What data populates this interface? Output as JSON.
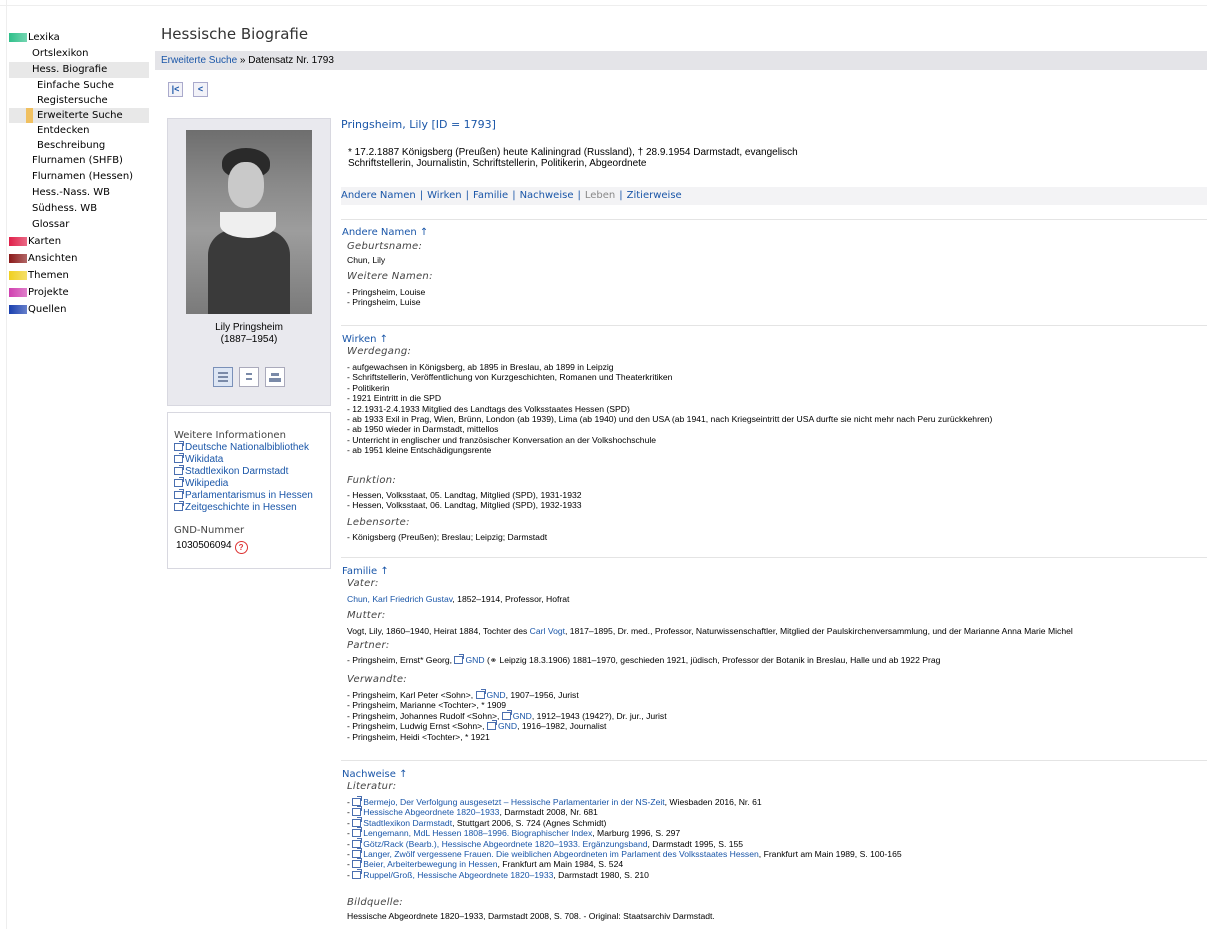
{
  "sidebar": {
    "items": [
      {
        "label": "Lexika",
        "kind": "cat",
        "color": "#2fc08a"
      },
      {
        "label": "Ortslexikon",
        "kind": "l1"
      },
      {
        "label": "Hess. Biografie",
        "kind": "l1",
        "selected": true
      },
      {
        "label": "Einfache Suche",
        "kind": "l2"
      },
      {
        "label": "Registersuche",
        "kind": "l2"
      },
      {
        "label": "Erweiterte Suche",
        "kind": "l2",
        "current": true
      },
      {
        "label": "Entdecken",
        "kind": "l2"
      },
      {
        "label": "Beschreibung",
        "kind": "l3"
      },
      {
        "label": "Flurnamen (SHFB)",
        "kind": "l1"
      },
      {
        "label": "Flurnamen (Hessen)",
        "kind": "l1"
      },
      {
        "label": "Hess.-Nass. WB",
        "kind": "l1"
      },
      {
        "label": "Südhess. WB",
        "kind": "l1"
      },
      {
        "label": "Glossar",
        "kind": "l1"
      },
      {
        "label": "Karten",
        "kind": "cat",
        "color": "#e0204a"
      },
      {
        "label": "Ansichten",
        "kind": "cat",
        "color": "#8b1a1a"
      },
      {
        "label": "Themen",
        "kind": "cat",
        "color": "#f0d020"
      },
      {
        "label": "Projekte",
        "kind": "cat",
        "color": "#d040b0"
      },
      {
        "label": "Quellen",
        "kind": "cat",
        "color": "#1a40b0"
      }
    ]
  },
  "header": {
    "title": "Hessische Biografie",
    "breadcrumb_link": "Erweiterte Suche",
    "breadcrumb_sep": " » ",
    "breadcrumb_current": "Datensatz Nr. 1793",
    "first_btn": "|<",
    "prev_btn": "<"
  },
  "portrait": {
    "name": "Lily Pringsheim",
    "years": "(1887–1954)"
  },
  "info": {
    "heading": "Weitere Informationen",
    "links": [
      "Deutsche Nationalbibliothek",
      "Wikidata",
      "Stadtlexikon Darmstadt",
      "Wikipedia",
      "Parlamentarismus in Hessen",
      "Zeitgeschichte in Hessen"
    ],
    "gnd_label": "GND-Nummer",
    "gnd_value": "1030506094",
    "help_glyph": "?"
  },
  "record": {
    "heading": "Pringsheim, Lily [ID = 1793]",
    "life": "* 17.2.1887 Königsberg (Preußen) heute Kaliningrad (Russland), † 28.9.1954 Darmstadt, evangelisch",
    "occupations": "Schriftstellerin, Journalistin, Schriftstellerin, Politikerin, Abgeordnete"
  },
  "tabs": [
    {
      "label": "Andere Namen",
      "enabled": true
    },
    {
      "label": "Wirken",
      "enabled": true
    },
    {
      "label": "Familie",
      "enabled": true
    },
    {
      "label": "Nachweise",
      "enabled": true
    },
    {
      "label": "Leben",
      "enabled": false
    },
    {
      "label": "Zitierweise",
      "enabled": true
    }
  ],
  "tab_separator": "|",
  "sections": {
    "andere_namen": {
      "heading": "Andere Namen ↑",
      "geburtsname_label": "Geburtsname:",
      "geburtsname": "Chun, Lily",
      "weitere_label": "Weitere Namen:",
      "weitere": [
        "- Pringsheim, Louise",
        "- Pringsheim, Luise"
      ]
    },
    "wirken": {
      "heading": "Wirken ↑",
      "werdegang_label": "Werdegang:",
      "werdegang": [
        "- aufgewachsen in Königsberg, ab 1895 in Breslau, ab 1899 in Leipzig",
        "- Schriftstellerin, Veröffentlichung von Kurzgeschichten, Romanen und Theaterkritiken",
        "- Politikerin",
        "- 1921 Eintritt in die SPD",
        "- 12.1931-2.4.1933 Mitglied des Landtags des Volksstaates Hessen (SPD)",
        "- ab 1933 Exil in Prag, Wien, Brünn, London (ab 1939), Lima (ab 1940) und den USA (ab 1941, nach Kriegseintritt der USA durfte sie nicht mehr nach Peru zurückkehren)",
        "- ab 1950 wieder in Darmstadt, mittellos",
        "- Unterricht in englischer und französischer Konversation an der Volkshochschule",
        "- ab 1951 kleine Entschädigungsrente"
      ],
      "funktion_label": "Funktion:",
      "funktion": [
        "- Hessen, Volksstaat, 05. Landtag, Mitglied (SPD), 1931-1932",
        "- Hessen, Volksstaat, 06. Landtag, Mitglied (SPD), 1932-1933"
      ],
      "lebensorte_label": "Lebensorte:",
      "lebensorte": "- Königsberg (Preußen); Breslau; Leipzig; Darmstadt"
    },
    "familie": {
      "heading": "Familie ↑",
      "vater_label": "Vater:",
      "vater_link": "Chun, Karl Friedrich Gustav",
      "vater_rest": ", 1852–1914, Professor, Hofrat",
      "mutter_label": "Mutter:",
      "mutter_pre": "Vogt, Lily, 1860–1940, Heirat 1884, Tochter des ",
      "mutter_link": "Carl Vogt",
      "mutter_post": ", 1817–1895, Dr. med., Professor, Naturwissenschaftler, Mitglied der Paulskirchenversammlung, und der Marianne Anna Marie Michel",
      "partner_label": "Partner:",
      "partner_pre": "- Pringsheim, Ernst* Georg, ",
      "partner_post": " (⚭ Leipzig 18.3.1906) 1881–1970, geschieden 1921, jüdisch, Professor der Botanik in Breslau, Halle und ab 1922 Prag",
      "gnd_text": "GND",
      "verwandte_label": "Verwandte:",
      "verwandte": [
        {
          "pre": "- Pringsheim, Karl Peter <Sohn>, ",
          "gnd": true,
          "post": ", 1907–1956, Jurist"
        },
        {
          "pre": "- Pringsheim, Marianne <Tochter>, * 1909",
          "gnd": false,
          "post": ""
        },
        {
          "pre": "- Pringsheim, Johannes Rudolf <Sohn>, ",
          "gnd": true,
          "post": ", 1912–1943 (1942?), Dr. jur., Jurist"
        },
        {
          "pre": "- Pringsheim, Ludwig Ernst <Sohn>, ",
          "gnd": true,
          "post": ", 1916–1982, Journalist"
        },
        {
          "pre": "- Pringsheim, Heidi <Tochter>, * 1921",
          "gnd": false,
          "post": ""
        }
      ]
    },
    "nachweise": {
      "heading": "Nachweise ↑",
      "literatur_label": "Literatur:",
      "literatur": [
        {
          "link": "Bermejo, Der Verfolgung ausgesetzt – Hessische Parlamentarier in der NS-Zeit",
          "rest": ", Wiesbaden 2016, Nr. 61"
        },
        {
          "link": "Hessische Abgeordnete 1820–1933",
          "rest": ", Darmstadt 2008, Nr. 681"
        },
        {
          "link": "Stadtlexikon Darmstadt",
          "rest": ", Stuttgart 2006, S. 724 (Agnes Schmidt)"
        },
        {
          "link": "Lengemann, MdL Hessen 1808–1996. Biographischer Index",
          "rest": ", Marburg 1996, S. 297"
        },
        {
          "link": "Götz/Rack (Bearb.), Hessische Abgeordnete 1820–1933. Ergänzungsband",
          "rest": ", Darmstadt 1995, S. 155"
        },
        {
          "link": "Langer, Zwölf vergessene Frauen. Die weiblichen Abgeordneten im Parlament des Volksstaates Hessen",
          "rest": ", Frankfurt am Main 1989, S. 100-165"
        },
        {
          "link": "Beier, Arbeiterbewegung in Hessen",
          "rest": ", Frankfurt am Main 1984, S. 524"
        },
        {
          "link": "Ruppel/Groß, Hessische Abgeordnete 1820–1933",
          "rest": ", Darmstadt 1980, S. 210"
        }
      ],
      "bildquelle_label": "Bildquelle:",
      "bildquelle": "Hessische Abgeordnete 1820–1933, Darmstadt 2008, S. 708. - Original: Staatsarchiv Darmstadt."
    }
  }
}
